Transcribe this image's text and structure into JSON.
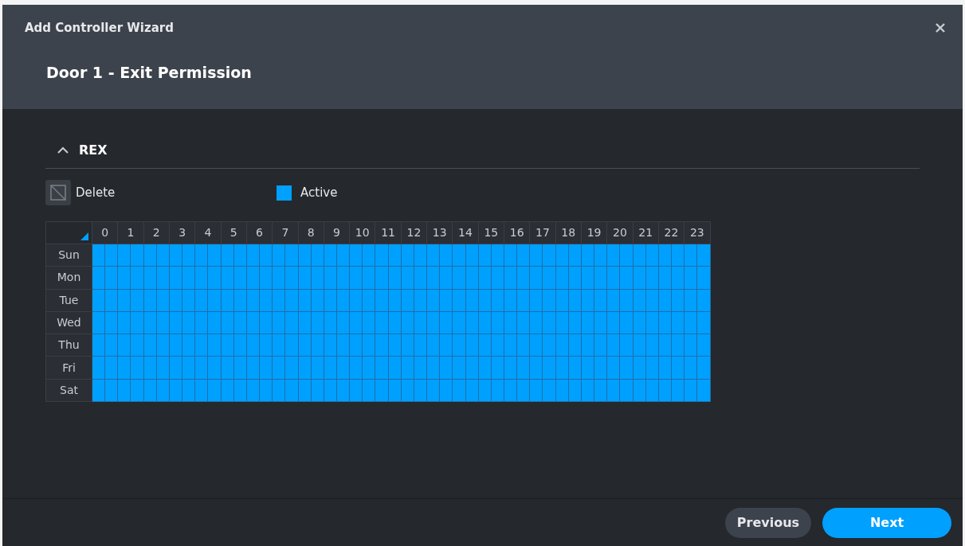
{
  "window": {
    "title": "Add Controller Wizard"
  },
  "page_title": "Door 1 - Exit Permission",
  "section": {
    "title": "REX",
    "expanded": true
  },
  "legend": [
    {
      "kind": "delete",
      "label": "Delete"
    },
    {
      "kind": "active",
      "label": "Active"
    }
  ],
  "schedule": {
    "hours": [
      "0",
      "1",
      "2",
      "3",
      "4",
      "5",
      "6",
      "7",
      "8",
      "9",
      "10",
      "11",
      "12",
      "13",
      "14",
      "15",
      "16",
      "17",
      "18",
      "19",
      "20",
      "21",
      "22",
      "23"
    ],
    "days": [
      {
        "label": "Sun",
        "slots": [
          true,
          true,
          true,
          true,
          true,
          true,
          true,
          true,
          true,
          true,
          true,
          true,
          true,
          true,
          true,
          true,
          true,
          true,
          true,
          true,
          true,
          true,
          true,
          true,
          true,
          true,
          true,
          true,
          true,
          true,
          true,
          true,
          true,
          true,
          true,
          true,
          true,
          true,
          true,
          true,
          true,
          true,
          true,
          true,
          true,
          true,
          true,
          true
        ]
      },
      {
        "label": "Mon",
        "slots": [
          true,
          true,
          true,
          true,
          true,
          true,
          true,
          true,
          true,
          true,
          true,
          true,
          true,
          true,
          true,
          true,
          true,
          true,
          true,
          true,
          true,
          true,
          true,
          true,
          true,
          true,
          true,
          true,
          true,
          true,
          true,
          true,
          true,
          true,
          true,
          true,
          true,
          true,
          true,
          true,
          true,
          true,
          true,
          true,
          true,
          true,
          true,
          true
        ]
      },
      {
        "label": "Tue",
        "slots": [
          true,
          true,
          true,
          true,
          true,
          true,
          true,
          true,
          true,
          true,
          true,
          true,
          true,
          true,
          true,
          true,
          true,
          true,
          true,
          true,
          true,
          true,
          true,
          true,
          true,
          true,
          true,
          true,
          true,
          true,
          true,
          true,
          true,
          true,
          true,
          true,
          true,
          true,
          true,
          true,
          true,
          true,
          true,
          true,
          true,
          true,
          true,
          true
        ]
      },
      {
        "label": "Wed",
        "slots": [
          true,
          true,
          true,
          true,
          true,
          true,
          true,
          true,
          true,
          true,
          true,
          true,
          true,
          true,
          true,
          true,
          true,
          true,
          true,
          true,
          true,
          true,
          true,
          true,
          true,
          true,
          true,
          true,
          true,
          true,
          true,
          true,
          true,
          true,
          true,
          true,
          true,
          true,
          true,
          true,
          true,
          true,
          true,
          true,
          true,
          true,
          true,
          true
        ]
      },
      {
        "label": "Thu",
        "slots": [
          true,
          true,
          true,
          true,
          true,
          true,
          true,
          true,
          true,
          true,
          true,
          true,
          true,
          true,
          true,
          true,
          true,
          true,
          true,
          true,
          true,
          true,
          true,
          true,
          true,
          true,
          true,
          true,
          true,
          true,
          true,
          true,
          true,
          true,
          true,
          true,
          true,
          true,
          true,
          true,
          true,
          true,
          true,
          true,
          true,
          true,
          true,
          true
        ]
      },
      {
        "label": "Fri",
        "slots": [
          true,
          true,
          true,
          true,
          true,
          true,
          true,
          true,
          true,
          true,
          true,
          true,
          true,
          true,
          true,
          true,
          true,
          true,
          true,
          true,
          true,
          true,
          true,
          true,
          true,
          true,
          true,
          true,
          true,
          true,
          true,
          true,
          true,
          true,
          true,
          true,
          true,
          true,
          true,
          true,
          true,
          true,
          true,
          true,
          true,
          true,
          true,
          true
        ]
      },
      {
        "label": "Sat",
        "slots": [
          true,
          true,
          true,
          true,
          true,
          true,
          true,
          true,
          true,
          true,
          true,
          true,
          true,
          true,
          true,
          true,
          true,
          true,
          true,
          true,
          true,
          true,
          true,
          true,
          true,
          true,
          true,
          true,
          true,
          true,
          true,
          true,
          true,
          true,
          true,
          true,
          true,
          true,
          true,
          true,
          true,
          true,
          true,
          true,
          true,
          true,
          true,
          true
        ]
      }
    ]
  },
  "buttons": [
    {
      "kind": "secondary",
      "label": "Previous"
    },
    {
      "kind": "primary",
      "label": "Next"
    }
  ]
}
